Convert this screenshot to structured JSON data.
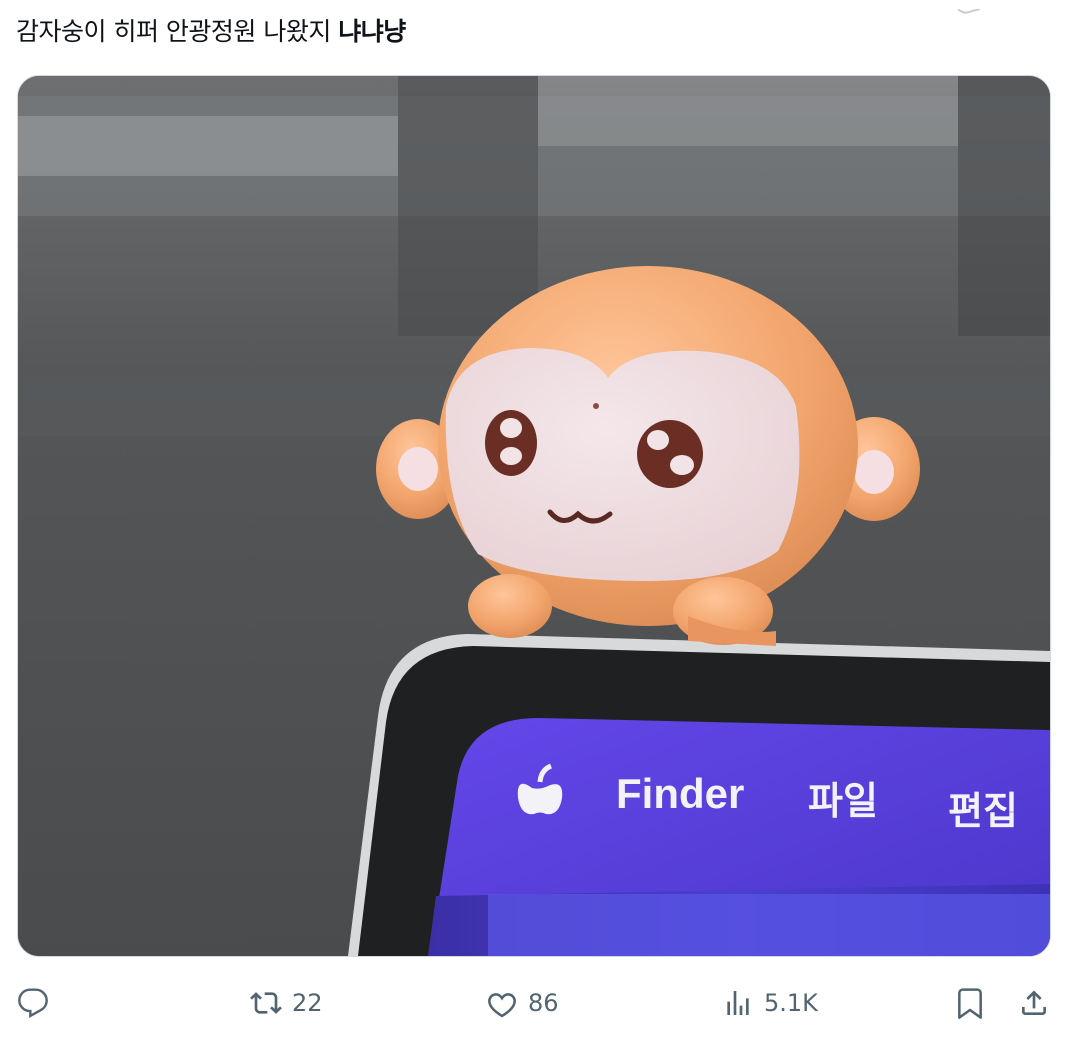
{
  "tweet": {
    "text_regular": "감자숭이 히퍼 안광정원 나왔지 ",
    "text_bold": "냐냐냥"
  },
  "media": {
    "menubar": {
      "apple": "apple-logo-icon",
      "items": [
        "Finder",
        "파일",
        "편집"
      ]
    }
  },
  "actions": {
    "reply": {
      "icon": "reply-icon",
      "count": ""
    },
    "repost": {
      "icon": "repost-icon",
      "count": "22"
    },
    "like": {
      "icon": "heart-icon",
      "count": "86"
    },
    "views": {
      "icon": "views-icon",
      "count": "5.1K"
    },
    "bookmark": {
      "icon": "bookmark-icon"
    },
    "share": {
      "icon": "share-icon"
    }
  },
  "colors": {
    "accent_text": "#0f1419",
    "muted": "#536471",
    "figure_orange": "#f0a870",
    "screen_purple": "#5b40e0"
  }
}
